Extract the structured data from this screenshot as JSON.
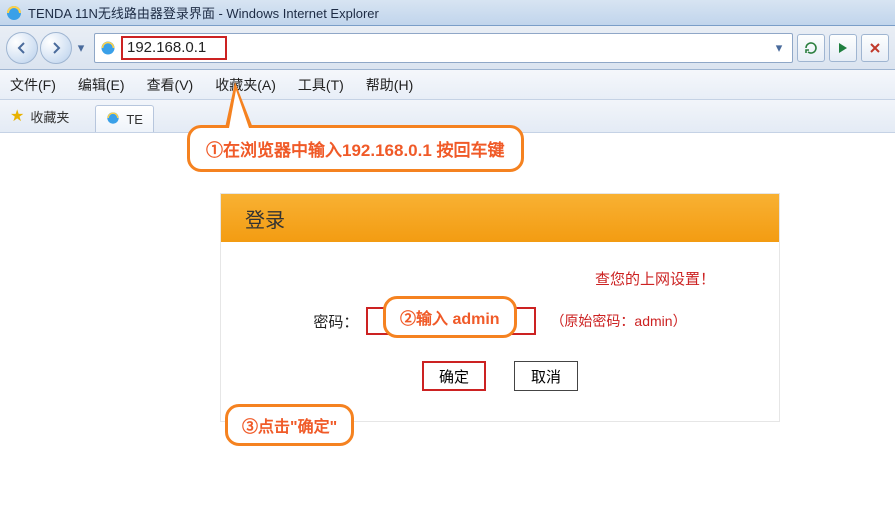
{
  "window": {
    "title": "TENDA 11N无线路由器登录界面 - Windows Internet Explorer"
  },
  "address_bar": {
    "url": "192.168.0.1"
  },
  "menu": {
    "file": "文件(F)",
    "edit": "编辑(E)",
    "view": "查看(V)",
    "favorites": "收藏夹(A)",
    "tools": "工具(T)",
    "help": "帮助(H)"
  },
  "fav_row": {
    "label": "收藏夹",
    "tab_label": "TE"
  },
  "callouts": {
    "c1": "①在浏览器中输入192.168.0.1 按回车键",
    "c2": "②输入 admin",
    "c3": "③点击\"确定\""
  },
  "login": {
    "header": "登录",
    "instruction_suffix": "查您的上网设置！",
    "password_label": "密码：",
    "password_hint": "（原始密码：admin）",
    "ok": "确定",
    "cancel": "取消"
  }
}
